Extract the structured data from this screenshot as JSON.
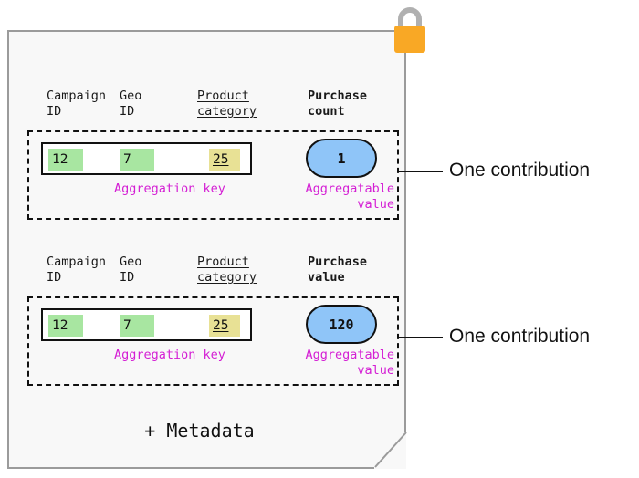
{
  "card": {
    "background_color": "#f8f8f8",
    "border_color": "#9b9b9b",
    "metadata_label": "+ Metadata"
  },
  "lock": {
    "icon": "lock-icon",
    "body_color": "#f9a825",
    "shackle_color": "#b0b0b0"
  },
  "colors": {
    "key_highlight_green": "#a8e6a1",
    "key_highlight_yellow": "#e8e195",
    "value_pill_blue": "#8fc5f8",
    "caption_purple": "#d41fd4",
    "outline_black": "#111111"
  },
  "columns": [
    {
      "label": "Campaign\nID",
      "style": "plain"
    },
    {
      "label": "Geo\nID",
      "style": "plain"
    },
    {
      "label": "Product\ncategory",
      "style": "underline"
    }
  ],
  "contributions": [
    {
      "measure_header": "Purchase\ncount",
      "key_cells": [
        {
          "value": "12",
          "highlight": "green"
        },
        {
          "value": "7",
          "highlight": "green"
        },
        {
          "value": "25",
          "highlight": "yellow",
          "underline": true
        }
      ],
      "aggregatable_value": "1",
      "key_caption": "Aggregation key",
      "value_caption": "Aggregatable value",
      "callout_label": "One contribution"
    },
    {
      "measure_header": "Purchase\nvalue",
      "key_cells": [
        {
          "value": "12",
          "highlight": "green"
        },
        {
          "value": "7",
          "highlight": "green"
        },
        {
          "value": "25",
          "highlight": "yellow",
          "underline": true
        }
      ],
      "aggregatable_value": "120",
      "key_caption": "Aggregation key",
      "value_caption": "Aggregatable value",
      "callout_label": "One contribution"
    }
  ]
}
